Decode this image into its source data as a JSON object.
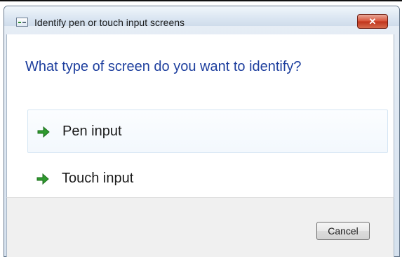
{
  "window": {
    "title": "Identify pen or touch input screens",
    "close_label": "✕"
  },
  "main": {
    "heading": "What type of screen do you want to identify?",
    "options": [
      {
        "label": "Pen input",
        "icon": "green-arrow-icon",
        "hovered": true
      },
      {
        "label": "Touch input",
        "icon": "green-arrow-icon",
        "hovered": false
      }
    ]
  },
  "footer": {
    "cancel_label": "Cancel"
  },
  "colors": {
    "heading": "#1e3f9e",
    "arrow": "#2e9a2e",
    "close_button": "#c8412a"
  }
}
